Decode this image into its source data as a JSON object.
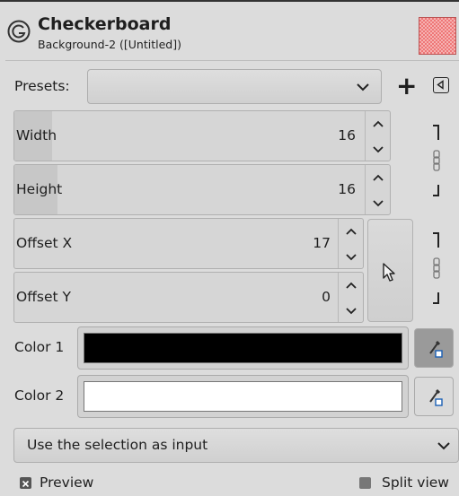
{
  "header": {
    "title": "Checkerboard",
    "subtitle": "Background-2 ([Untitled])",
    "icon": "gimp-filter-icon",
    "swatch_color": "#f6b1b1"
  },
  "presets": {
    "label": "Presets:",
    "value": "",
    "add_icon": "+",
    "manage_icon": "left-triangle-icon"
  },
  "width": {
    "label": "Width",
    "value": "16",
    "fill_fraction": 0.07
  },
  "height": {
    "label": "Height",
    "value": "16",
    "fill_fraction": 0.07
  },
  "offset_x": {
    "label": "Offset X",
    "value": "17"
  },
  "offset_y": {
    "label": "Offset Y",
    "value": "0"
  },
  "color1": {
    "label": "Color 1",
    "value": "#000000"
  },
  "color2": {
    "label": "Color 2",
    "value": "#ffffff"
  },
  "input_mode": {
    "value": "Use the selection as input"
  },
  "preview": {
    "label": "Preview",
    "checked": true
  },
  "split_view": {
    "label": "Split view",
    "checked": false
  }
}
